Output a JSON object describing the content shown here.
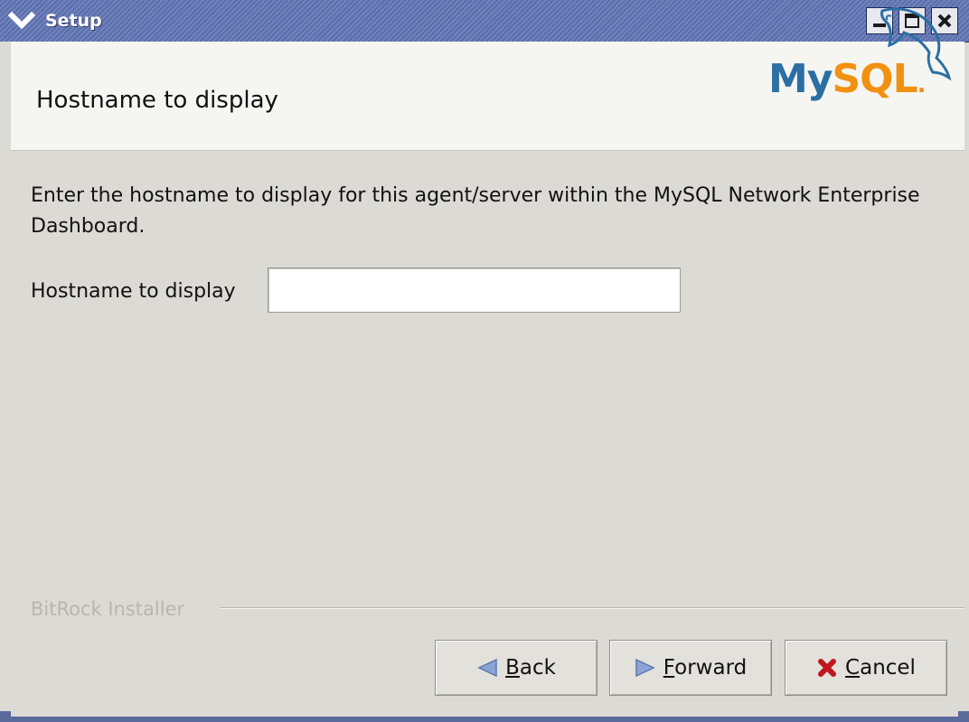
{
  "window": {
    "title": "Setup",
    "controls": {
      "menu_icon": "chevron-down-icon",
      "minimize_icon": "minimize-icon",
      "maximize_icon": "maximize-icon",
      "close_icon": "close-icon"
    }
  },
  "header": {
    "title": "Hostname to display",
    "logo": {
      "text_my": "My",
      "text_sql": "SQL",
      "dot": ".",
      "icon": "dolphin-icon"
    }
  },
  "body": {
    "description": "Enter the hostname to display for this agent/server within the MySQL Network Enterprise Dashboard.",
    "field": {
      "label": "Hostname to display",
      "value": ""
    }
  },
  "footer": {
    "brand": "BitRock Installer",
    "buttons": {
      "back": {
        "label": "Back",
        "icon": "back-arrow-icon"
      },
      "forward": {
        "label": "Forward",
        "icon": "forward-arrow-icon"
      },
      "cancel": {
        "label": "Cancel",
        "icon": "cancel-x-icon"
      }
    }
  },
  "colors": {
    "titlebar": "#6577b2",
    "logo_blue": "#2b6fa3",
    "logo_orange": "#f29111",
    "cancel_red": "#c0171f",
    "arrow_blue": "#6e8ec8"
  }
}
